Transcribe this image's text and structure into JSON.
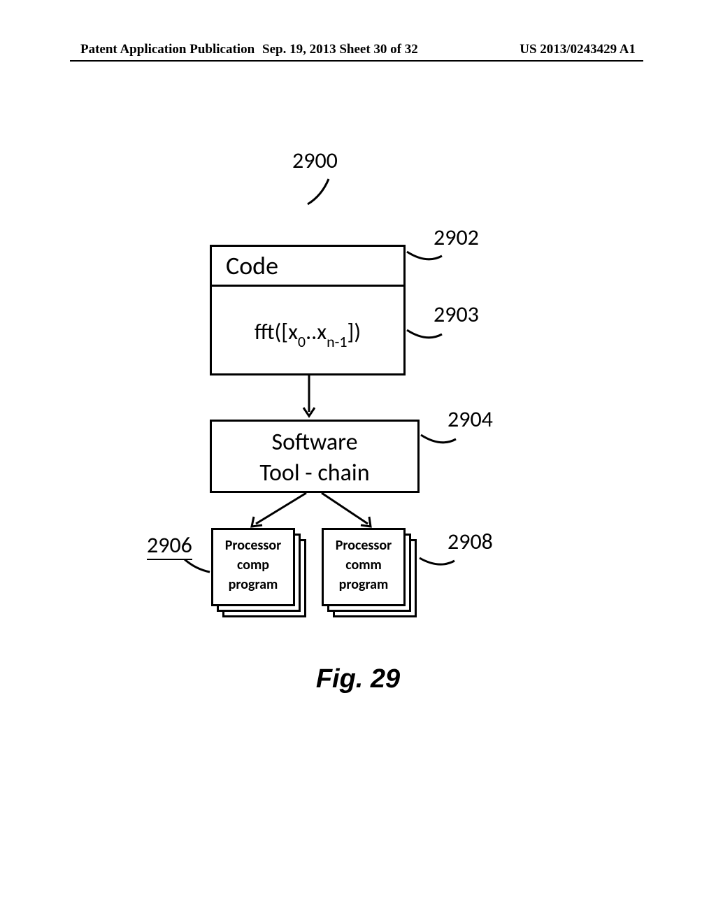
{
  "header": {
    "left": "Patent Application Publication",
    "center": "Sep. 19, 2013  Sheet 30 of 32",
    "right": "US 2013/0243429 A1"
  },
  "figure": {
    "caption": "Fig. 29",
    "refs": {
      "system": "2900",
      "code_header": "2902",
      "code_body": "2903",
      "toolchain": "2904",
      "left_stack": "2906",
      "right_stack": "2908"
    },
    "blocks": {
      "code_label": "Code",
      "fft_prefix": "fft([x",
      "fft_sub0": "0",
      "fft_mid": "..x",
      "fft_sub1": "n-1",
      "fft_suffix": "])",
      "toolchain_line1": "Software",
      "toolchain_line2": "Tool - chain",
      "left_line1": "Processor",
      "left_line2": "comp",
      "left_line3": "program",
      "right_line1": "Processor",
      "right_line2": "comm",
      "right_line3": "program"
    }
  }
}
